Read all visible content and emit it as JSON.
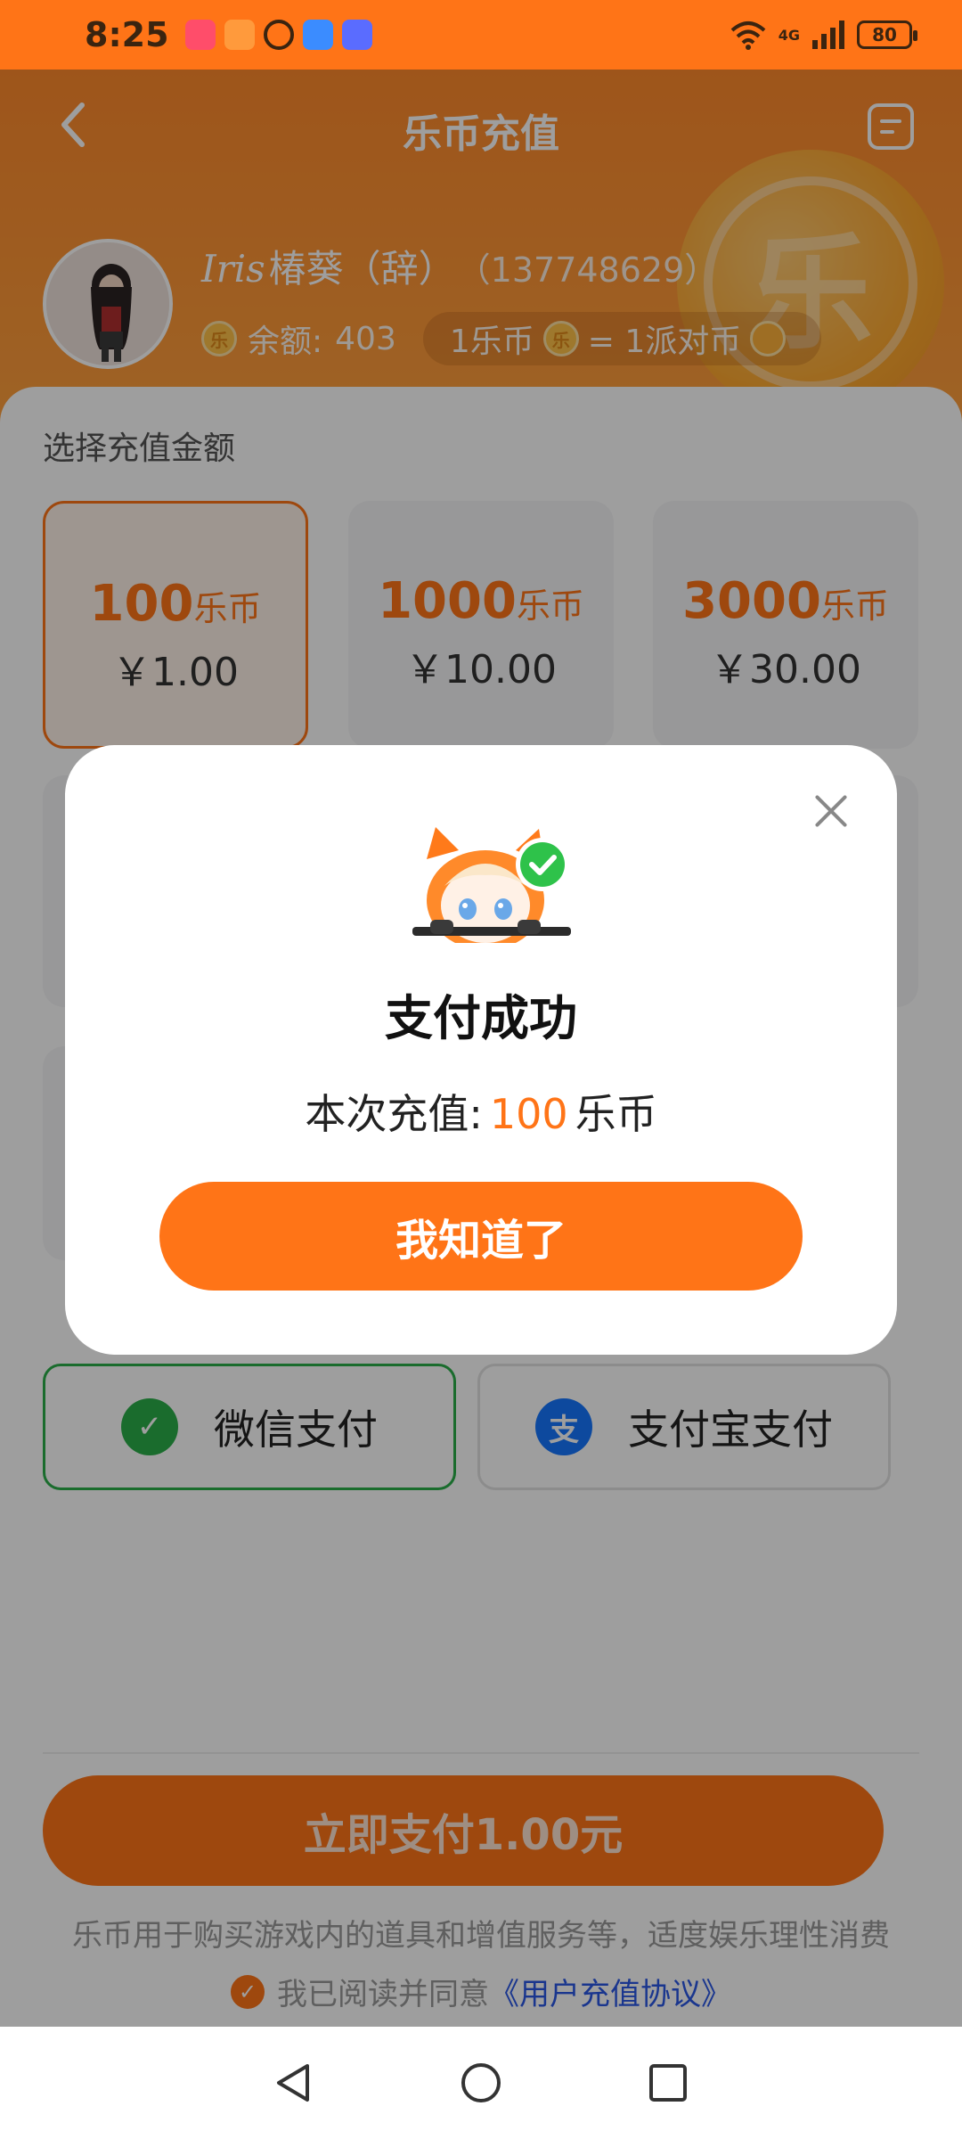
{
  "status_bar": {
    "time": "8:25",
    "network": "4G",
    "battery": "80",
    "app_icon_colors": [
      "#ff4d6a",
      "#ff9a3c",
      "#3b8cff",
      "#5a6cff"
    ]
  },
  "header": {
    "title": "乐币充值",
    "back_icon": "chevron-left-icon",
    "record_icon": "record-list-icon",
    "watermark_coin": "乐"
  },
  "user": {
    "name_script": "Iris",
    "name": "椿葵（辞）",
    "id": "（137748629）",
    "balance_label": "余额:",
    "balance_value": "403",
    "coin_glyph": "乐",
    "rate_left": "1乐币",
    "rate_right": "= 1派对币"
  },
  "recharge": {
    "section_label": "选择充值金额",
    "options": [
      {
        "coins": "100",
        "unit": "乐币",
        "price": "￥1.00",
        "selected": true
      },
      {
        "coins": "1000",
        "unit": "乐币",
        "price": "￥10.00",
        "selected": false
      },
      {
        "coins": "3000",
        "unit": "乐币",
        "price": "￥30.00",
        "selected": false
      }
    ]
  },
  "payment": {
    "wechat_label": "微信支付",
    "wechat_icon_glyph": "✓",
    "alipay_label": "支付宝支付",
    "alipay_icon_glyph": "支",
    "pay_now": "立即支付1.00元",
    "notice": "乐币用于购买游戏内的道具和增值服务等，适度娱乐理性消费",
    "agree_prefix": "我已阅读并同意",
    "agree_link": "《用户充值协议》",
    "agree_check_glyph": "✓"
  },
  "modal": {
    "title": "支付成功",
    "msg_prefix": "本次充值:",
    "msg_amount": "100",
    "msg_suffix": "乐币",
    "ok_label": "我知道了"
  },
  "colors": {
    "accent": "#ff7417",
    "wechat": "#2aae4a",
    "alipay": "#1677ff",
    "link": "#2a57e6"
  }
}
